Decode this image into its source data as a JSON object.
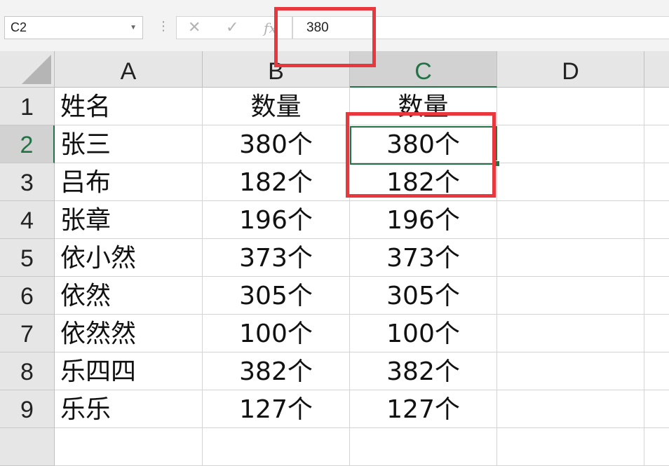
{
  "name_box": {
    "value": "C2"
  },
  "formula_bar": {
    "cancel_glyph": "✕",
    "enter_glyph": "✓",
    "fx_label": "fx",
    "value": "380"
  },
  "columns": [
    "A",
    "B",
    "C",
    "D"
  ],
  "active_column": "C",
  "active_row": "2",
  "rows": [
    {
      "num": "1",
      "a": "姓名",
      "b": "数量",
      "c": "数量"
    },
    {
      "num": "2",
      "a": "张三",
      "b": "380个",
      "c": "380个"
    },
    {
      "num": "3",
      "a": "吕布",
      "b": "182个",
      "c": "182个"
    },
    {
      "num": "4",
      "a": "张章",
      "b": "196个",
      "c": "196个"
    },
    {
      "num": "5",
      "a": "依小然",
      "b": "373个",
      "c": "373个"
    },
    {
      "num": "6",
      "a": "依然",
      "b": "305个",
      "c": "305个"
    },
    {
      "num": "7",
      "a": "依然然",
      "b": "100个",
      "c": "100个"
    },
    {
      "num": "8",
      "a": "乐四四",
      "b": "382个",
      "c": "382个"
    },
    {
      "num": "9",
      "a": "乐乐",
      "b": "127个",
      "c": "127个"
    }
  ],
  "colors": {
    "accent_green": "#217346",
    "annotation_red": "#e8383d"
  },
  "icons": [
    "dropdown-arrow-icon",
    "cancel-icon",
    "enter-icon",
    "fx-icon",
    "select-all-triangle-icon"
  ]
}
